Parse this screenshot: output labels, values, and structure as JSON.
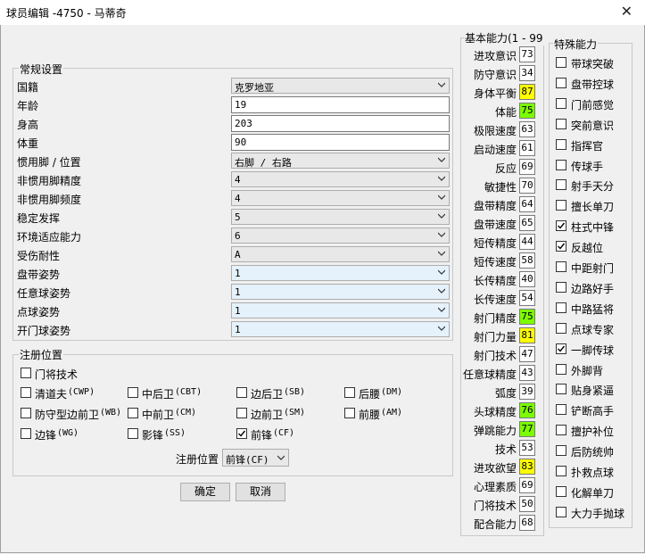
{
  "window": {
    "title": "球员编辑 -4750 - 马蒂奇",
    "close_glyph": "✕"
  },
  "general": {
    "legend": "常规设置",
    "rows": [
      {
        "label": "国籍",
        "kind": "combo",
        "value": "克罗地亚"
      },
      {
        "label": "年龄",
        "kind": "edit",
        "value": "19"
      },
      {
        "label": "身高",
        "kind": "edit",
        "value": "203"
      },
      {
        "label": "体重",
        "kind": "edit",
        "value": "90"
      },
      {
        "label": "惯用脚 / 位置",
        "kind": "combo",
        "value": "右脚 / 右路"
      },
      {
        "label": "非惯用脚精度",
        "kind": "combo",
        "value": "4"
      },
      {
        "label": "非惯用脚频度",
        "kind": "combo",
        "value": "4"
      },
      {
        "label": "稳定发挥",
        "kind": "combo",
        "value": "5"
      },
      {
        "label": "环境适应能力",
        "kind": "combo",
        "value": "6"
      },
      {
        "label": "受伤耐性",
        "kind": "combo",
        "value": "A"
      },
      {
        "label": "盘带姿势",
        "kind": "combo",
        "value": "1"
      },
      {
        "label": "任意球姿势",
        "kind": "combo",
        "value": "1"
      },
      {
        "label": "点球姿势",
        "kind": "combo",
        "value": "1"
      },
      {
        "label": "开门球姿势",
        "kind": "combo",
        "value": "1"
      }
    ]
  },
  "registered": {
    "legend": "注册位置",
    "positions": [
      {
        "label": "门将技术",
        "code": "",
        "checked": false
      },
      {
        "label": "清道夫",
        "code": "(CWP)",
        "checked": false
      },
      {
        "label": "中后卫",
        "code": "(CBT)",
        "checked": false
      },
      {
        "label": "边后卫",
        "code": "(SB)",
        "checked": false
      },
      {
        "label": "后腰",
        "code": "(DM)",
        "checked": false
      },
      {
        "label": "防守型边前卫",
        "code": "(WB)",
        "checked": false
      },
      {
        "label": "中前卫",
        "code": "(CM)",
        "checked": false
      },
      {
        "label": "边前卫",
        "code": "(SM)",
        "checked": false
      },
      {
        "label": "前腰",
        "code": "(AM)",
        "checked": false
      },
      {
        "label": "边锋",
        "code": "(WG)",
        "checked": false
      },
      {
        "label": "影锋",
        "code": "(SS)",
        "checked": false
      },
      {
        "label": "前锋",
        "code": "(CF)",
        "checked": true
      }
    ],
    "select_label": "注册位置",
    "select_value": "前锋(CF)"
  },
  "buttons": {
    "ok": "确定",
    "cancel": "取消"
  },
  "abilities": {
    "legend": "基本能力(1 - 99",
    "colors": {
      "green": "#7cfc00",
      "yellow": "#ffff00",
      "white": "#ffffff"
    },
    "items": [
      {
        "label": "进攻意识",
        "value": "73",
        "color": "white"
      },
      {
        "label": "防守意识",
        "value": "34",
        "color": "white"
      },
      {
        "label": "身体平衡",
        "value": "87",
        "color": "yellow"
      },
      {
        "label": "体能",
        "value": "75",
        "color": "green"
      },
      {
        "label": "极限速度",
        "value": "63",
        "color": "white"
      },
      {
        "label": "启动速度",
        "value": "61",
        "color": "white"
      },
      {
        "label": "反应",
        "value": "69",
        "color": "white"
      },
      {
        "label": "敏捷性",
        "value": "70",
        "color": "white"
      },
      {
        "label": "盘带精度",
        "value": "64",
        "color": "white"
      },
      {
        "label": "盘带速度",
        "value": "65",
        "color": "white"
      },
      {
        "label": "短传精度",
        "value": "44",
        "color": "white"
      },
      {
        "label": "短传速度",
        "value": "58",
        "color": "white"
      },
      {
        "label": "长传精度",
        "value": "40",
        "color": "white"
      },
      {
        "label": "长传速度",
        "value": "54",
        "color": "white"
      },
      {
        "label": "射门精度",
        "value": "75",
        "color": "green"
      },
      {
        "label": "射门力量",
        "value": "81",
        "color": "yellow"
      },
      {
        "label": "射门技术",
        "value": "47",
        "color": "white"
      },
      {
        "label": "任意球精度",
        "value": "43",
        "color": "white"
      },
      {
        "label": "弧度",
        "value": "39",
        "color": "white"
      },
      {
        "label": "头球精度",
        "value": "76",
        "color": "green"
      },
      {
        "label": "弹跳能力",
        "value": "77",
        "color": "green"
      },
      {
        "label": "技术",
        "value": "53",
        "color": "white"
      },
      {
        "label": "进攻欲望",
        "value": "83",
        "color": "yellow"
      },
      {
        "label": "心理素质",
        "value": "69",
        "color": "white"
      },
      {
        "label": "门将技术",
        "value": "50",
        "color": "white"
      },
      {
        "label": "配合能力",
        "value": "68",
        "color": "white"
      }
    ]
  },
  "special": {
    "legend": "特殊能力",
    "items": [
      {
        "label": "带球突破",
        "checked": false
      },
      {
        "label": "盘带控球",
        "checked": false
      },
      {
        "label": "门前感觉",
        "checked": false
      },
      {
        "label": "突前意识",
        "checked": false
      },
      {
        "label": "指挥官",
        "checked": false
      },
      {
        "label": "传球手",
        "checked": false
      },
      {
        "label": "射手天分",
        "checked": false
      },
      {
        "label": "擅长单刀",
        "checked": false
      },
      {
        "label": "柱式中锋",
        "checked": true
      },
      {
        "label": "反越位",
        "checked": true
      },
      {
        "label": "中距射门",
        "checked": false
      },
      {
        "label": "边路好手",
        "checked": false
      },
      {
        "label": "中路猛将",
        "checked": false
      },
      {
        "label": "点球专家",
        "checked": false
      },
      {
        "label": "一脚传球",
        "checked": true
      },
      {
        "label": "外脚背",
        "checked": false
      },
      {
        "label": "贴身紧逼",
        "checked": false
      },
      {
        "label": "铲断高手",
        "checked": false
      },
      {
        "label": "擅护补位",
        "checked": false
      },
      {
        "label": "后防统帅",
        "checked": false
      },
      {
        "label": "扑救点球",
        "checked": false
      },
      {
        "label": "化解单刀",
        "checked": false
      },
      {
        "label": "大力手抛球",
        "checked": false
      }
    ]
  }
}
